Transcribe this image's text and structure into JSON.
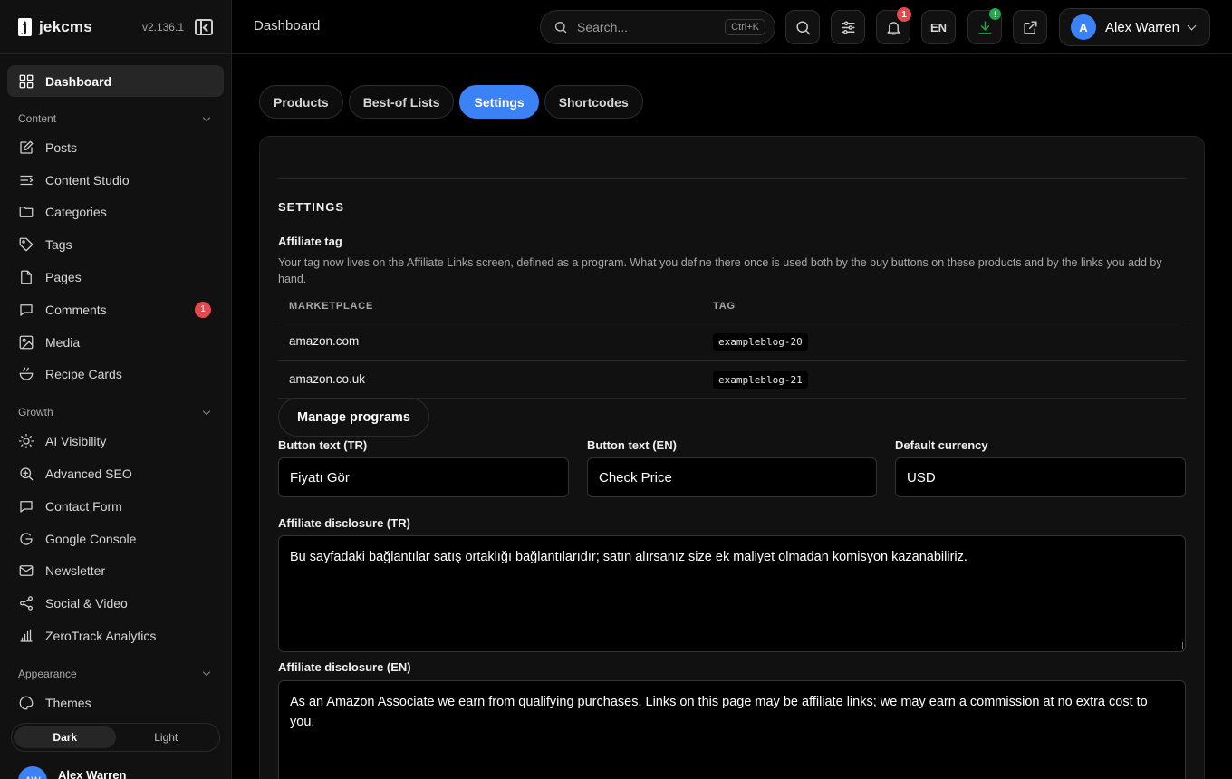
{
  "app": {
    "name": "jekcms",
    "version": "v2.136.1"
  },
  "sidebar": {
    "dashboard": "Dashboard",
    "sections": [
      {
        "title": "Content",
        "items": [
          {
            "label": "Posts",
            "icon": "edit-icon"
          },
          {
            "label": "Content Studio",
            "icon": "studio-icon"
          },
          {
            "label": "Categories",
            "icon": "folder-icon"
          },
          {
            "label": "Tags",
            "icon": "tag-icon"
          },
          {
            "label": "Pages",
            "icon": "file-icon"
          },
          {
            "label": "Comments",
            "icon": "comment-icon",
            "badge": "1"
          },
          {
            "label": "Media",
            "icon": "image-icon"
          },
          {
            "label": "Recipe Cards",
            "icon": "bowl-icon"
          }
        ]
      },
      {
        "title": "Growth",
        "items": [
          {
            "label": "AI Visibility",
            "icon": "sun-icon"
          },
          {
            "label": "Advanced SEO",
            "icon": "zoom-in-icon"
          },
          {
            "label": "Contact Form",
            "icon": "message-icon"
          },
          {
            "label": "Google Console",
            "icon": "google-icon"
          },
          {
            "label": "Newsletter",
            "icon": "mail-icon"
          },
          {
            "label": "Social & Video",
            "icon": "share-icon"
          },
          {
            "label": "ZeroTrack Analytics",
            "icon": "bar-chart-icon"
          }
        ]
      },
      {
        "title": "Appearance",
        "items": [
          {
            "label": "Themes",
            "icon": "palette-icon"
          }
        ]
      }
    ],
    "theme": {
      "dark": "Dark",
      "light": "Light",
      "selected": "Dark"
    },
    "user": {
      "initials": "AW",
      "name": "Alex Warren"
    }
  },
  "topbar": {
    "title": "Dashboard",
    "search_placeholder": "Search...",
    "search_shortcut": "Ctrl+K",
    "notifications_count": "1",
    "language": "EN",
    "download_badge": "!",
    "user": {
      "initial": "A",
      "name": "Alex Warren"
    }
  },
  "tabs": [
    {
      "label": "Products"
    },
    {
      "label": "Best-of Lists"
    },
    {
      "label": "Settings",
      "active": true
    },
    {
      "label": "Shortcodes"
    }
  ],
  "settings": {
    "heading": "SETTINGS",
    "affiliate_tag_label": "Affiliate tag",
    "affiliate_tag_help": "Your tag now lives on the Affiliate Links screen, defined as a program. What you define there once is used both by the buy buttons on these products and by the links you add by hand.",
    "table": {
      "columns": [
        "MARKETPLACE",
        "TAG"
      ],
      "rows": [
        {
          "marketplace": "amazon.com",
          "tag": "exampleblog-20"
        },
        {
          "marketplace": "amazon.co.uk",
          "tag": "exampleblog-21"
        }
      ]
    },
    "manage_programs": "Manage programs",
    "button_text_tr_label": "Button text (TR)",
    "button_text_tr": "Fiyatı Gör",
    "button_text_en_label": "Button text (EN)",
    "button_text_en": "Check Price",
    "currency_label": "Default currency",
    "currency": "USD",
    "disclosure_tr_label": "Affiliate disclosure (TR)",
    "disclosure_tr": "Bu sayfadaki bağlantılar satış ortaklığı bağlantılarıdır; satın alırsanız size ek maliyet olmadan komisyon kazanabiliriz.",
    "disclosure_en_label": "Affiliate disclosure (EN)",
    "disclosure_en": "As an Amazon Associate we earn from qualifying purchases. Links on this page may be affiliate links; we may earn a commission at no extra cost to you."
  },
  "colors": {
    "accent": "#3b82f6",
    "badge": "#e5484d",
    "success": "#22a84a",
    "panel": "#111111"
  }
}
